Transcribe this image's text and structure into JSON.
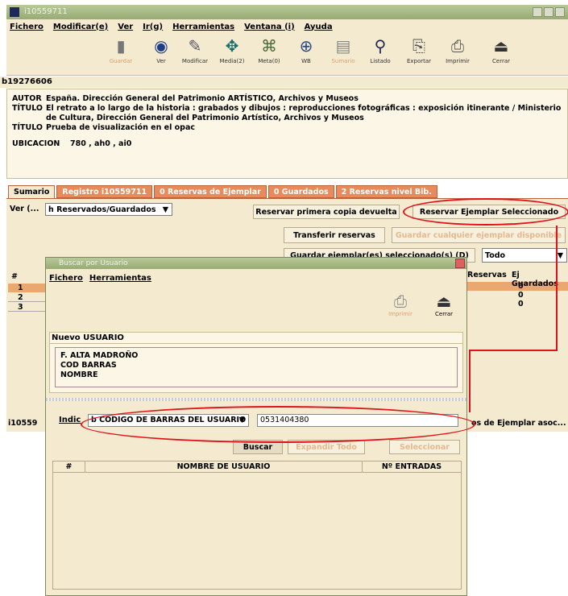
{
  "window": {
    "title": "i10559711"
  },
  "menu": [
    "Fichero",
    "Modificar(e)",
    "Ver",
    "Ir(g)",
    "Herramientas",
    "Ventana (i)",
    "Ayuda"
  ],
  "toolbar": [
    {
      "label": "Guardar",
      "icon": "save-icon",
      "disabled": true
    },
    {
      "label": "Ver",
      "icon": "view-icon",
      "disabled": false
    },
    {
      "label": "Modificar",
      "icon": "edit-icon",
      "disabled": false
    },
    {
      "label": "Media(2)",
      "icon": "media-icon",
      "disabled": false
    },
    {
      "label": "Meta(0)",
      "icon": "meta-icon",
      "disabled": false
    },
    {
      "label": "WB",
      "icon": "web-icon",
      "disabled": false
    },
    {
      "label": "Sumario",
      "icon": "summary-icon",
      "disabled": true
    },
    {
      "label": "Listado",
      "icon": "search-icon",
      "disabled": false
    },
    {
      "label": "Exportar",
      "icon": "export-icon",
      "disabled": false
    },
    {
      "label": "Imprimir",
      "icon": "printer-icon",
      "disabled": false
    },
    {
      "label": "Cerrar",
      "icon": "close-icon",
      "disabled": false
    }
  ],
  "record": {
    "number": "b19276606",
    "fields": [
      {
        "label": "AUTOR",
        "value": "España. Dirección General del Patrimonio ARTÍSTICO, Archivos y Museos"
      },
      {
        "label": "TÍTULO",
        "value": "El retrato a lo largo de la historia : grabados y dibujos : reproducciones fotográficas : exposición itinerante / Ministerio de Cultura, Dirección General del Patrimonio Artístico, Archivos y Museos"
      },
      {
        "label": "TÍTULO",
        "value": "Prueba de visualización en el opac"
      }
    ],
    "location_label": "UBICACION",
    "location_value": "780 , ah0 , ai0"
  },
  "tabs": [
    "Sumario",
    "Registro i10559711",
    "0 Reservas de Ejemplar",
    "0 Guardados",
    "2 Reservas nivel Bib."
  ],
  "main": {
    "view_label": "Ver (...",
    "view_select": "h Reservados/Guardados",
    "btn_reserve_first": "Reservar primera copia devuelta",
    "btn_reserve_selected": "Reservar Ejemplar Seleccionado",
    "btn_transfer": "Transferir reservas",
    "btn_save_available": "Guardar cualquier ejemplar disponible",
    "btn_save_selected": "Guardar ejemplar(es) seleccionado(s) (D)",
    "todo_select": "Todo",
    "table_headers": [
      "#",
      "Reservas",
      "Ej Guardados"
    ],
    "table_rows": [
      {
        "num": "1",
        "reservas": "",
        "guardados": "0"
      },
      {
        "num": "2",
        "reservas": "",
        "guardados": "0"
      },
      {
        "num": "3",
        "reservas": "",
        "guardados": "0"
      }
    ],
    "bottom_left": "i10559",
    "bottom_right": "os de Ejemplar asoc..."
  },
  "dialog": {
    "title": "Buscar por Usuario",
    "menu": [
      "Fichero",
      "Herramientas"
    ],
    "btn_print": "Imprimir",
    "btn_close": "Cerrar",
    "new_user_label": "Nuevo USUARIO",
    "user_lines": [
      "F. ALTA MADROÑO",
      "COD BARRAS",
      "NOMBRE"
    ],
    "index_label": "Indic",
    "index_select": "b CODIGO DE BARRAS DEL USUARIO",
    "index_value": "0531404380",
    "btn_search": "Buscar",
    "btn_expand": "Expandir Todo",
    "btn_select": "Seleccionar",
    "result_headers": [
      "#",
      "NOMBRE DE USUARIO",
      "Nº ENTRADAS"
    ]
  },
  "colors": {
    "accent_tab": "#e88a5a",
    "panel": "#f3ead0",
    "highlight": "#e2121a"
  }
}
